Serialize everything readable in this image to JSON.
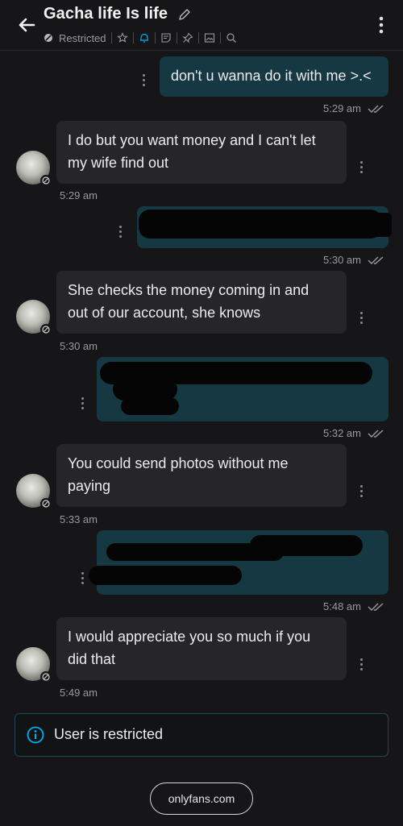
{
  "header": {
    "title": "Gacha life Is life",
    "status": "Restricted",
    "icons": [
      "back-arrow-icon",
      "edit-pencil-icon",
      "restricted-icon",
      "star-icon",
      "bell-icon",
      "note-icon",
      "pin-icon",
      "image-icon",
      "search-icon",
      "more-vertical-icon"
    ]
  },
  "messages": [
    {
      "id": "m1",
      "dir": "out",
      "text": "don't u wanna do it with me >.<",
      "time": ""
    },
    {
      "id": "m1t",
      "dir": "out",
      "time": "5:29 am"
    },
    {
      "id": "m2",
      "dir": "in",
      "text_lines": [
        "I do but you want money and I can't let",
        "my wife find out"
      ],
      "time": "5:29 am"
    },
    {
      "id": "m3",
      "dir": "out",
      "text": "",
      "time": "5:30 am",
      "redacted": true
    },
    {
      "id": "m4",
      "dir": "in",
      "text_lines": [
        "She checks the money coming in and",
        "out of our account, she knows"
      ],
      "time": "5:30 am"
    },
    {
      "id": "m5",
      "dir": "out",
      "text": "",
      "time": "5:32 am",
      "redacted": true
    },
    {
      "id": "m6",
      "dir": "in",
      "text_lines": [
        "You could send photos without me",
        "paying"
      ],
      "time": "5:33 am"
    },
    {
      "id": "m7",
      "dir": "out",
      "text": "",
      "time": "5:48 am",
      "redacted": true
    },
    {
      "id": "m8",
      "dir": "in",
      "text_lines": [
        "I would appreciate you so much if you",
        "did that"
      ],
      "time": "5:49 am"
    }
  ],
  "notice": {
    "text": "User is restricted",
    "icon": "info-icon"
  },
  "footer": {
    "label": "onlyfans.com"
  },
  "colors": {
    "bg": "#161618",
    "outgoing": "#163843",
    "incoming": "#262629",
    "accent": "#00aff0"
  }
}
